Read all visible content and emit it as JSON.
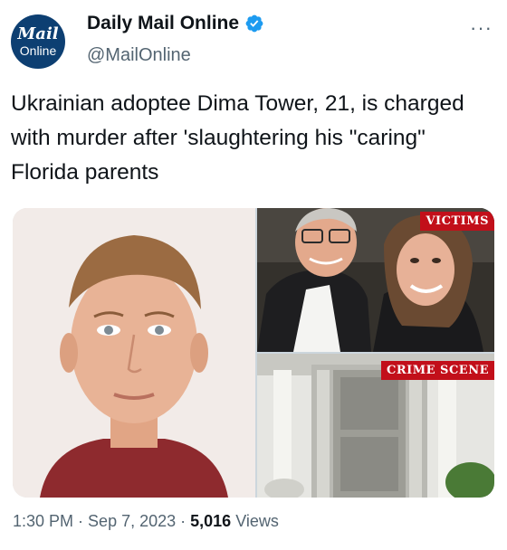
{
  "author": {
    "avatar_line1": "Mail",
    "avatar_line2": "Online",
    "name": "Daily Mail Online",
    "handle": "@MailOnline",
    "verified_color": "#1d9bf0"
  },
  "more_label": "···",
  "tweet": {
    "text": "Ukrainian adoptee Dima Tower, 21, is charged with murder after 'slaughtering his \"caring\" Florida parents"
  },
  "media": {
    "tag_victims": "VICTIMS",
    "tag_scene": "CRIME SCENE",
    "tag_color": "#c20f1a"
  },
  "meta": {
    "time": "1:30 PM",
    "date": "Sep 7, 2023",
    "views_count": "5,016",
    "views_label": "Views"
  }
}
